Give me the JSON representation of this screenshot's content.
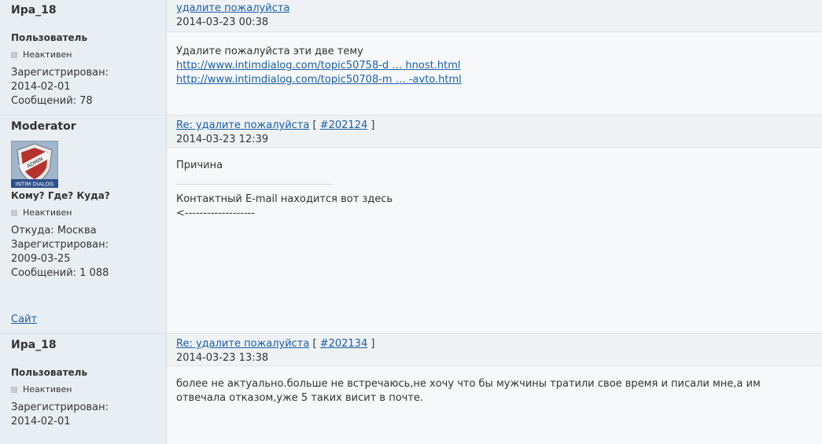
{
  "posts": [
    {
      "author": "Ира_18",
      "role": "Пользователь",
      "status": "Неактивен",
      "registered_label": "Зарегистрирован:",
      "registered": "2014-02-01",
      "messages": "Сообщений: 78",
      "title_link": "удалите пожалуйста",
      "date": "2014-03-23 00:38",
      "body_text": "Удалите пожалуйста эти две тему",
      "links": [
        "http://www.intimdialog.com/topic50758-d … hnost.html",
        "http://www.intimdialog.com/topic50708-m … -avto.html"
      ]
    },
    {
      "author": "Moderator",
      "role": "Кому? Где? Куда?",
      "status": "Неактивен",
      "from": "Откуда: Москва",
      "registered_label": "Зарегистрирован:",
      "registered": "2009-03-25",
      "messages": "Сообщений: 1 088",
      "site_link": "Сайт",
      "title_link": "Re: удалите пожалуйста",
      "post_id": "#202124",
      "date": "2014-03-23 12:39",
      "body_text": "Причина",
      "signature_line1": "Контактный E-mail находится вот здесь",
      "signature_line2": "<-------------------"
    },
    {
      "author": "Ира_18",
      "role": "Пользователь",
      "status": "Неактивен",
      "registered_label": "Зарегистрирован:",
      "registered": "2014-02-01",
      "title_link": "Re: удалите пожалуйста",
      "post_id": "#202134",
      "date": "2014-03-23 13:38",
      "body_text": "более не актуально.больше не встречаюсь,не хочу что бы мужчины тратили свое время и писали мне,а им отвечала отказом,уже 5 таких висит в почте."
    }
  ],
  "avatar": {
    "badge_text": "ADMIN",
    "label": "INTIM DIALOG"
  },
  "colors": {
    "link": "#1a5fa8",
    "sidebar": "#e9eef3",
    "content": "#f7f8f9"
  }
}
